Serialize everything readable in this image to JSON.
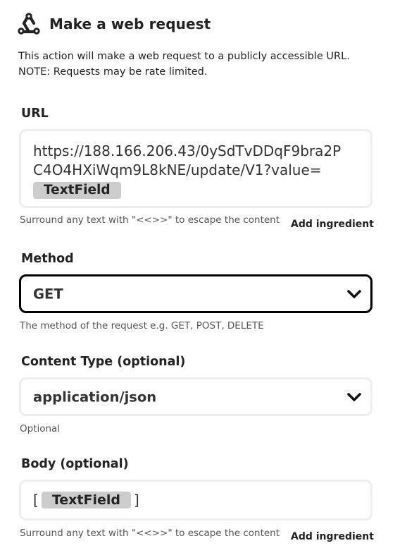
{
  "header": {
    "title": "Make a web request",
    "icon": "webhook-icon"
  },
  "description": {
    "line1": "This action will make a web request to a publicly accessible URL.",
    "line2": "NOTE: Requests may be rate limited."
  },
  "url": {
    "label": "URL",
    "line1": "https://188.166.206.43/0ySdTvDDqF9bra2P",
    "line2": "C4O4HXiWqm9L8kNE/update/V1?value=",
    "ingredient": "TextField",
    "help": "Surround any text with \"<<>>\" to escape the content",
    "add_ingredient": "Add ingredient"
  },
  "method": {
    "label": "Method",
    "value": "GET",
    "help": "The method of the request e.g. GET, POST, DELETE"
  },
  "content_type": {
    "label": "Content Type (optional)",
    "value": "application/json",
    "help": "Optional"
  },
  "body": {
    "label": "Body (optional)",
    "open_bracket": "[",
    "ingredient": "TextField",
    "close_bracket": "]",
    "help": "Surround any text with \"<<>>\" to escape the content",
    "add_ingredient": "Add ingredient"
  },
  "colors": {
    "field_border": "#eeeeee",
    "active_border": "#000000",
    "pill_bg": "#cccccc",
    "text": "#222222",
    "help_text": "#555555"
  }
}
